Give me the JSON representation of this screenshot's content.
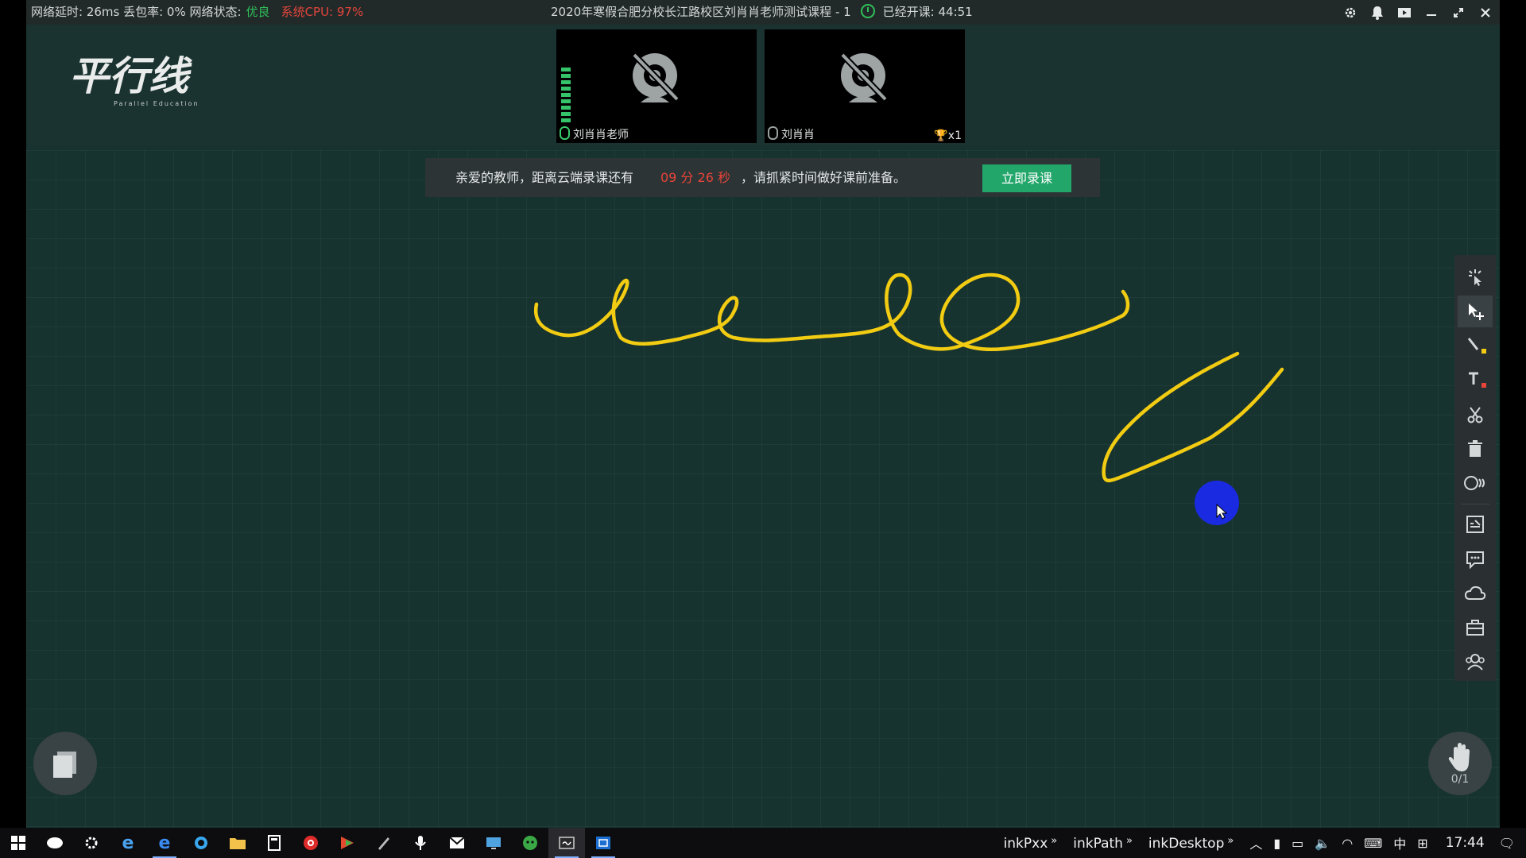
{
  "titlebar": {
    "stats": "网络延时: 26ms 丢包率: 0% 网络状态:",
    "network_quality": "优良",
    "cpu": "系统CPU: 97%",
    "course_title": "2020年寒假合肥分校长江路校区刘肖肖老师测试课程 - 1",
    "elapsed": "已经开课: 44:51"
  },
  "logo": {
    "main": "平行线",
    "sub": "Parallel Education"
  },
  "videos": [
    {
      "name": "刘肖肖老师"
    },
    {
      "name": "刘肖肖",
      "trophy": "x1"
    }
  ],
  "notice": {
    "text_before": "亲爱的教师，距离云端录课还有",
    "timer": "09 分 26 秒",
    "text_after": "，请抓紧时间做好课前准备。",
    "button": "立即录课"
  },
  "hand_raise": {
    "count": "0/1"
  },
  "colors": {
    "ink": "#f2cc12",
    "accent_green": "#22a66a",
    "warning_red": "#e8443a",
    "cursor": "#1a2ae0"
  },
  "toolbar_icons": [
    "laser-pointer-icon",
    "select-move-icon",
    "pen-icon",
    "text-icon",
    "scissors-icon",
    "trash-icon",
    "shapes-icon",
    "formula-icon",
    "comment-icon",
    "cloud-icon",
    "toolbox-icon",
    "students-icon"
  ],
  "taskbar": {
    "links": [
      "inkPxx",
      "inkPath",
      "inkDesktop"
    ],
    "ime": "中",
    "time": "17:44"
  }
}
